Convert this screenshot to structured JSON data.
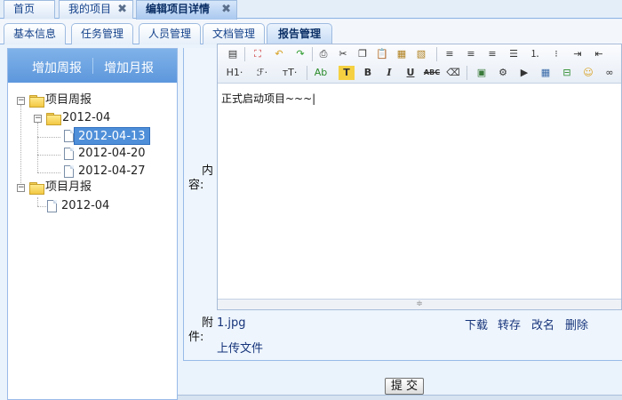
{
  "top_tabs": [
    {
      "label": "首页"
    },
    {
      "label": "我的项目",
      "close": "✖"
    },
    {
      "label": "编辑项目详情",
      "close": "✖"
    }
  ],
  "sub_tabs": [
    {
      "label": "基本信息"
    },
    {
      "label": "任务管理"
    },
    {
      "label": "人员管理"
    },
    {
      "label": "文档管理"
    },
    {
      "label": "报告管理"
    }
  ],
  "left": {
    "add_weekly": "增加周报",
    "add_monthly": "增加月报",
    "tree": [
      {
        "label": "项目周报",
        "icon": "folder-icon",
        "toggle": "−"
      },
      {
        "label": "2012-04",
        "icon": "folder-icon",
        "toggle": "−"
      },
      {
        "label": "2012-04-13",
        "icon": "document-icon",
        "selected": true
      },
      {
        "label": "2012-04-20",
        "icon": "document-icon"
      },
      {
        "label": "2012-04-27",
        "icon": "document-icon"
      },
      {
        "label": "项目月报",
        "icon": "folder-icon",
        "toggle": "−"
      },
      {
        "label": "2012-04",
        "icon": "document-icon"
      }
    ]
  },
  "form": {
    "content_label_1": "内",
    "content_label_2": "容:",
    "editor_text": "正式启动项目~~~|",
    "attachment_label_1": "附",
    "attachment_label_2": "件:",
    "attachment_file": "1.jpg",
    "download": "下载",
    "save_as": "转存",
    "rename": "改名",
    "delete": "删除",
    "upload": "上传文件",
    "submit": "提 交"
  },
  "toolbar": {
    "heading": "H1·",
    "font": "ℱ·",
    "font_size": "тT·",
    "font_color": "Ab",
    "highlight": "T",
    "bold": "B",
    "italic": "I",
    "underline": "U",
    "strikethrough": "ABC"
  },
  "colors": {
    "accent": "#5d97dc",
    "tab_text": "#15428b",
    "highlight_bg": "#f5d142"
  }
}
